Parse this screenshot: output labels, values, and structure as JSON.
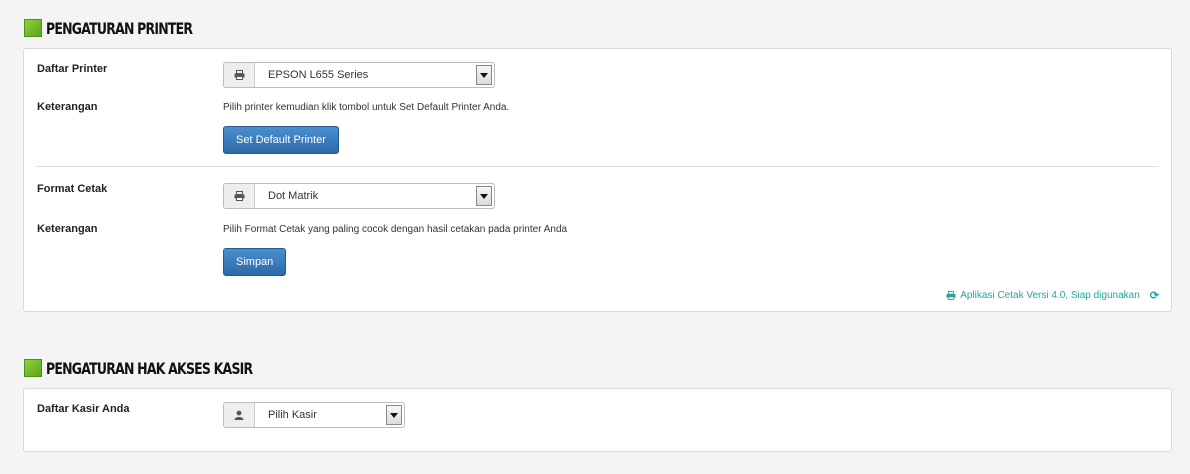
{
  "printer_section": {
    "title": "Pengaturan Printer",
    "daftar_printer_label": "Daftar Printer",
    "printer_select_value": "EPSON L655 Series",
    "keterangan_label_1": "Keterangan",
    "keterangan_text_1": "Pilih printer kemudian klik tombol untuk Set Default Printer Anda.",
    "set_default_button": "Set Default Printer",
    "format_cetak_label": "Format Cetak",
    "format_select_value": "Dot Matrik",
    "keterangan_label_2": "Keterangan",
    "keterangan_text_2": "Pilih Format Cetak yang paling cocok dengan hasil cetakan pada printer Anda",
    "simpan_button": "Simpan",
    "status_text": "Aplikasi Cetak Versi 4.0, Siap digunakan"
  },
  "kasir_section": {
    "title": "Pengaturan Hak Akses Kasir",
    "daftar_kasir_label": "Daftar Kasir Anda",
    "kasir_select_value": "Pilih Kasir"
  },
  "icons": {
    "printer": "printer-icon",
    "user": "user-icon",
    "refresh": "refresh-icon",
    "dropdown": "chevron-down-icon"
  },
  "colors": {
    "accent_green": "#6cbb2a",
    "button_blue": "#3a7bbd",
    "status_teal": "#1fa8a0"
  }
}
